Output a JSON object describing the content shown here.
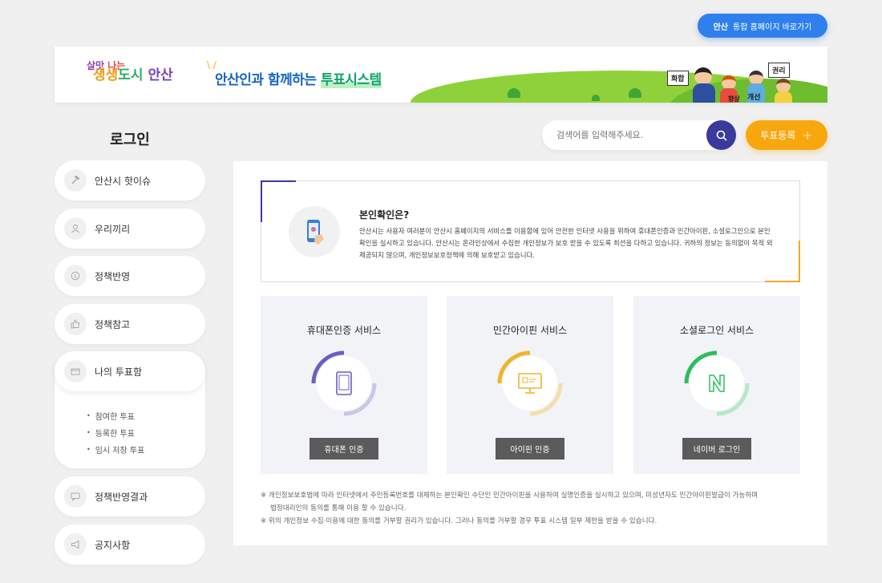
{
  "top_link": {
    "logo": "안산",
    "label": "통합 홈페이지 바로가기"
  },
  "banner": {
    "brand_line1_a": "살맛",
    "brand_line1_b": " 나는",
    "brand_line2_a": "생생",
    "brand_line2_b": "도시 ",
    "brand_line2_c": "안산",
    "title_a": "안산인과 함께하는 ",
    "title_b": "투표시스템",
    "signs": [
      "화합",
      "향상",
      "개선",
      "권리"
    ]
  },
  "search": {
    "placeholder": "검색어를 입력해주세요."
  },
  "register_button": {
    "label": "투표등록",
    "plus": "+"
  },
  "sidebar": {
    "title": "로그인",
    "items": [
      {
        "label": "안산시 핫이슈",
        "icon": "hammer-icon"
      },
      {
        "label": "우리끼리",
        "icon": "person-icon"
      },
      {
        "label": "정책반영",
        "icon": "coin-icon"
      },
      {
        "label": "정책참고",
        "icon": "thumbs-up-icon"
      },
      {
        "label": "나의 투표함",
        "icon": "box-icon"
      },
      {
        "label": "정책반영결과",
        "icon": "chat-icon"
      },
      {
        "label": "공지사항",
        "icon": "megaphone-icon"
      }
    ],
    "sub_items": [
      "참여한 투표",
      "등록한 투표",
      "임시 저장 투표"
    ]
  },
  "intro": {
    "title": "본인확인은?",
    "body": "안산시는 사용자 여러분이 안산시 홈페이지의 서비스를 이용함에 있어 안전한 인터넷 사용을 위하여 휴대폰인증과 민간아이핀, 소셜로그인으로 본인확인을 실시하고 있습니다. 안산시는 온라인상에서 수집한 개인정보가 보호 받을 수 있도록 최선을 다하고 있습니다. 귀하의 정보는 동의없이 목적 외 제공되지 않으며, 개인정보보호정책에 의해 보호받고 있습니다."
  },
  "services": [
    {
      "title": "휴대폰인증 서비스",
      "button": "휴대폰 인증",
      "color": "#6a5fc1",
      "icon": "phone-icon"
    },
    {
      "title": "민간아이핀 서비스",
      "button": "아이핀 인증",
      "color": "#f0b429",
      "icon": "monitor-icon"
    },
    {
      "title": "소셜로그인 서비스",
      "button": "네이버 로그인",
      "color": "#2ebd5b",
      "icon": "naver-icon"
    }
  ],
  "notes": {
    "line1": "※ 개인정보보호법에 따라 인터넷에서 주민등록번호를 대체하는 본인확인 수단인 민간아이핀을 사용하여 실명인증을 실시하고 있으며, 미성년자도 민간아이핀발급이 가능하며",
    "line2": "법정대리인의 동의를 통해 이용 할 수 있습니다.",
    "line3": "※ 위의 개인정보 수집·이용에 대한 동의를 거부할 권리가 있습니다. 그러나 동의를 거부할 경우 투표 시스템 일부 제한을 받을 수 있습니다."
  }
}
